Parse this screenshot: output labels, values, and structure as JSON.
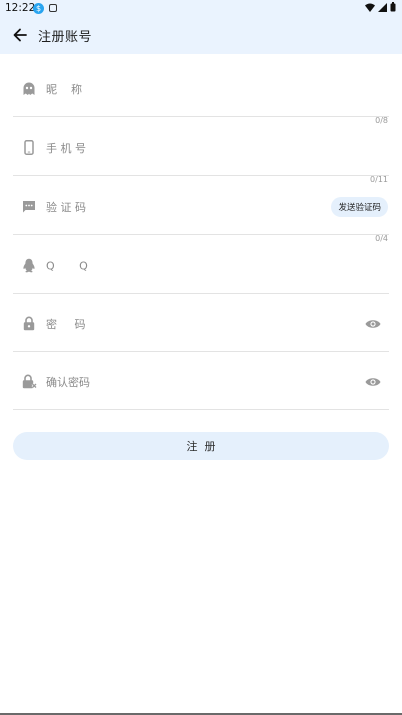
{
  "statusbar": {
    "time": "12:22",
    "badge": "$"
  },
  "appbar": {
    "title": "注册账号"
  },
  "form": {
    "nickname_label": "昵    称",
    "nickname_counter": "0/8",
    "phone_label": "手 机 号",
    "phone_counter": "0/11",
    "code_label": "验 证 码",
    "send_code_label": "发送验证码",
    "code_counter": "0/4",
    "qq_label": "Q       Q",
    "password_label": "密     码",
    "confirm_label": "确认密码"
  },
  "submit_label": "注  册",
  "colors": {
    "header_bg": "#eaf3fe",
    "button_bg": "#e5f0fc",
    "icon": "#9a9a9a"
  },
  "icons": [
    "ghost-icon",
    "phone-icon",
    "message-icon",
    "qq-penguin-icon",
    "lock-icon",
    "lock-cancel-icon",
    "eye-icon",
    "back-arrow-icon"
  ]
}
